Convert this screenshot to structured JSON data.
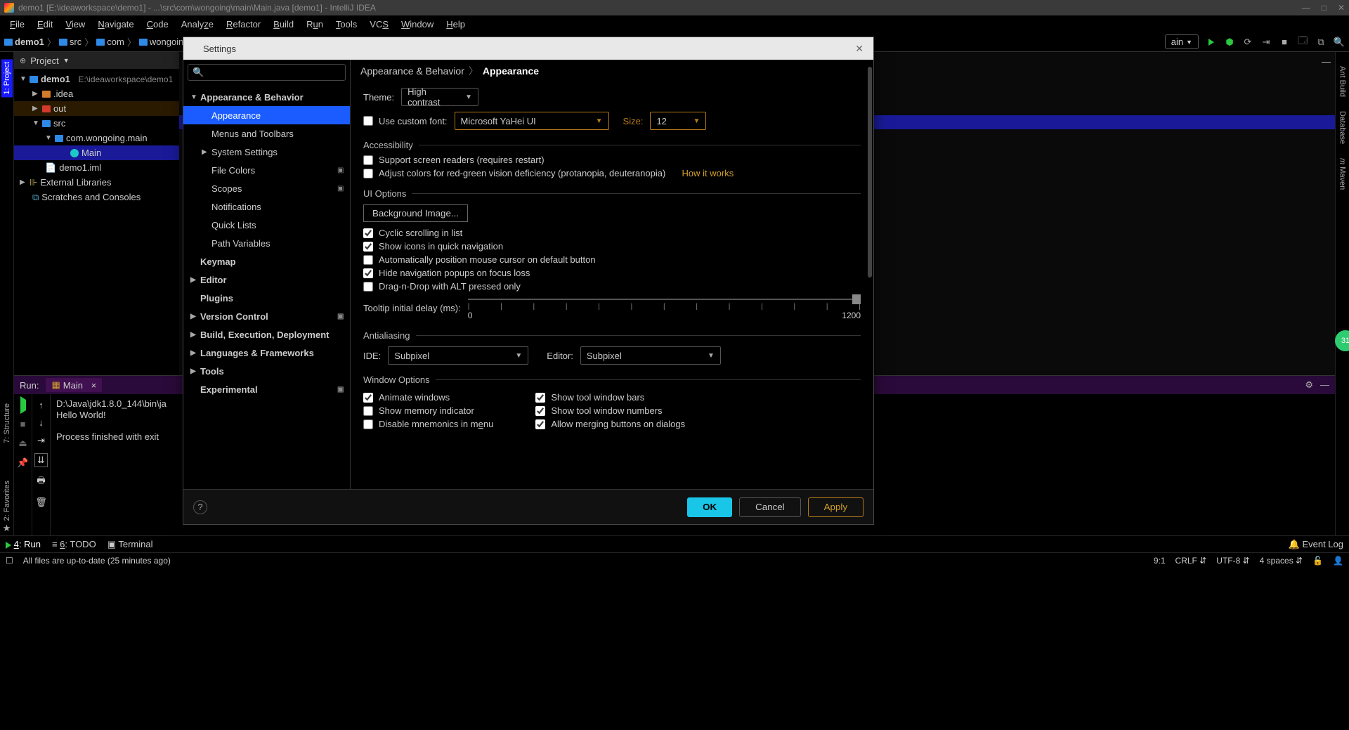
{
  "titlebar": {
    "text": "demo1 [E:\\ideaworkspace\\demo1] - ...\\src\\com\\wongoing\\main\\Main.java [demo1] - IntelliJ IDEA"
  },
  "menu": [
    "File",
    "Edit",
    "View",
    "Navigate",
    "Code",
    "Analyze",
    "Refactor",
    "Build",
    "Run",
    "Tools",
    "VCS",
    "Window",
    "Help"
  ],
  "breadcrumb": [
    "demo1",
    "src",
    "com",
    "wongoing"
  ],
  "runconfig": "ain",
  "left_tabs": {
    "project": "1: Project",
    "structure": "7: Structure",
    "favorites": "2: Favorites"
  },
  "right_tabs": {
    "ant": "Ant Build",
    "database": "Database",
    "maven": "Maven"
  },
  "project": {
    "header": "Project",
    "root": "demo1",
    "root_path": "E:\\ideaworkspace\\demo1",
    "idea": ".idea",
    "out": "out",
    "src": "src",
    "pkg": "com.wongoing.main",
    "main": "Main",
    "iml": "demo1.iml",
    "ext": "External Libraries",
    "scratch": "Scratches and Consoles"
  },
  "run": {
    "label": "Run:",
    "tab": "Main",
    "line1": "D:\\Java\\jdk1.8.0_144\\bin\\ja",
    "line2": "Hello World!",
    "line3": "Process finished with exit"
  },
  "bottom": {
    "run": "4: Run",
    "todo": "6: TODO",
    "terminal": "Terminal",
    "eventlog": "Event Log"
  },
  "status": {
    "msg": "All files are up-to-date (25 minutes ago)",
    "pos": "9:1",
    "crlf": "CRLF",
    "enc": "UTF-8",
    "spaces": "4 spaces"
  },
  "dialog": {
    "title": "Settings",
    "search_placeholder": "",
    "tree": {
      "appearance_behavior": "Appearance & Behavior",
      "appearance": "Appearance",
      "menus": "Menus and Toolbars",
      "system": "System Settings",
      "filecolors": "File Colors",
      "scopes": "Scopes",
      "notifications": "Notifications",
      "quicklists": "Quick Lists",
      "pathvars": "Path Variables",
      "keymap": "Keymap",
      "editor": "Editor",
      "plugins": "Plugins",
      "vc": "Version Control",
      "build": "Build, Execution, Deployment",
      "lang": "Languages & Frameworks",
      "tools": "Tools",
      "experimental": "Experimental"
    },
    "bc1": "Appearance & Behavior",
    "bc2": "Appearance",
    "theme_label": "Theme:",
    "theme_value": "High contrast",
    "use_custom_font": "Use custom font:",
    "font_value": "Microsoft YaHei UI",
    "size_label": "Size:",
    "size_value": "12",
    "accessibility": "Accessibility",
    "screen_readers": "Support screen readers (requires restart)",
    "colorblind": "Adjust colors for red-green vision deficiency (protanopia, deuteranopia)",
    "how_it_works": "How it works",
    "ui_options": "UI Options",
    "bg_image": "Background Image...",
    "cyclic": "Cyclic scrolling in list",
    "show_icons": "Show icons in quick navigation",
    "auto_mouse": "Automatically position mouse cursor on default button",
    "hide_nav": "Hide navigation popups on focus loss",
    "drag_alt": "Drag-n-Drop with ALT pressed only",
    "tooltip_label": "Tooltip initial delay (ms):",
    "tooltip_min": "0",
    "tooltip_max": "1200",
    "antialiasing": "Antialiasing",
    "ide_label": "IDE:",
    "ide_value": "Subpixel",
    "editor_label": "Editor:",
    "editor_value": "Subpixel",
    "window_options": "Window Options",
    "animate": "Animate windows",
    "memory": "Show memory indicator",
    "mnemonics": "Disable mnemonics in menu",
    "tool_bars": "Show tool window bars",
    "tool_numbers": "Show tool window numbers",
    "merge_buttons": "Allow merging buttons on dialogs",
    "ok": "OK",
    "cancel": "Cancel",
    "apply": "Apply"
  },
  "bubble": "31"
}
